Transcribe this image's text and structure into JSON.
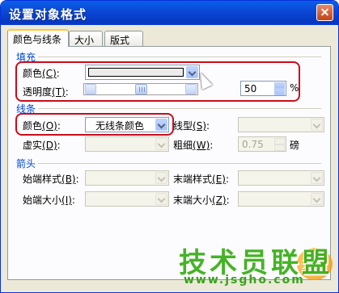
{
  "window": {
    "title": "设置对象格式"
  },
  "tabs": [
    {
      "label": "颜色与线条",
      "active": true
    },
    {
      "label": "大小",
      "active": false
    },
    {
      "label": "版式",
      "active": false
    }
  ],
  "fill": {
    "section_label": "填充",
    "color_label": "颜色",
    "color_key": "(C)",
    "color_value": "#ebebeb",
    "transparency_label": "透明度",
    "transparency_key": "(T)",
    "transparency_value": "50",
    "transparency_unit": "%"
  },
  "line": {
    "section_label": "线条",
    "color_label": "颜色",
    "color_key": "(O)",
    "color_value": "无线条颜色",
    "dash_label": "虚实",
    "dash_key": "(D)",
    "style_label": "线型",
    "style_key": "(S)",
    "weight_label": "粗细",
    "weight_key": "(W)",
    "weight_value": "0.75",
    "weight_unit": "磅"
  },
  "arrows": {
    "section_label": "箭头",
    "begin_style_label": "始端样式",
    "begin_style_key": "(B)",
    "end_style_label": "末端样式",
    "end_style_key": "(E)",
    "begin_size_label": "始端大小",
    "begin_size_key": "(I)",
    "end_size_label": "末端大小",
    "end_size_key": "(Z)"
  },
  "watermark": {
    "text": "技术员联盟",
    "url": "www.jsgho.com",
    "logo_text": "天极"
  },
  "colors": {
    "highlight": "#c80d1a",
    "section_text": "#0046d5",
    "title_bar": "#0a5fe8"
  }
}
